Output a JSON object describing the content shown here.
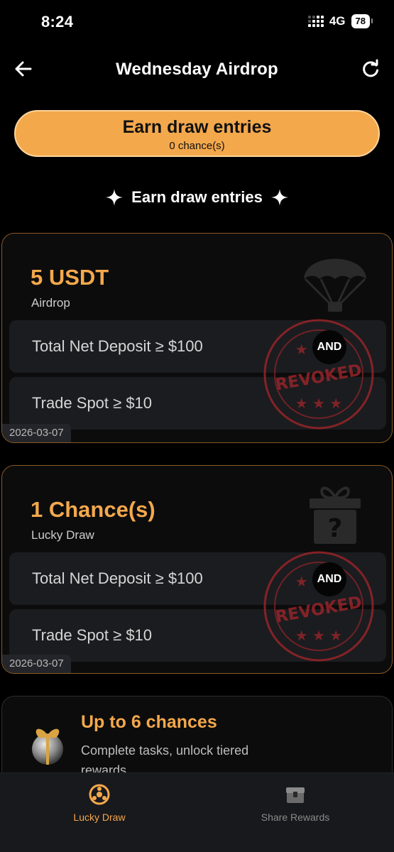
{
  "status": {
    "time": "8:24",
    "network": "4G",
    "battery": "78"
  },
  "nav": {
    "title": "Wednesday Airdrop"
  },
  "earn_button": {
    "label": "Earn draw entries",
    "chances": "0 chance(s)"
  },
  "section": {
    "title": "Earn draw entries"
  },
  "cards": [
    {
      "amount": "5 USDT",
      "kind": "Airdrop",
      "art": "parachute-icon",
      "tasks": [
        "Total Net Deposit ≥ $100",
        "Trade Spot ≥ $10"
      ],
      "connector": "AND",
      "stamp": "REVOKED",
      "date": "2026-03-07"
    },
    {
      "amount": "1 Chance(s)",
      "kind": "Lucky Draw",
      "art": "mystery-gift-icon",
      "tasks": [
        "Total Net Deposit ≥ $100",
        "Trade Spot ≥ $10"
      ],
      "connector": "AND",
      "stamp": "REVOKED",
      "date": "2026-03-07"
    }
  ],
  "bonus": {
    "title": "Up to 6 chances",
    "description": "Complete tasks, unlock tiered rewards"
  },
  "tabs": [
    {
      "label": "Lucky Draw",
      "icon": "lucky-draw-icon",
      "active": true
    },
    {
      "label": "Share Rewards",
      "icon": "share-rewards-icon",
      "active": false
    }
  ],
  "colors": {
    "accent": "#f4a84c",
    "stamp": "#a8262b",
    "card_border": "#8a5a24",
    "background": "#000000"
  }
}
